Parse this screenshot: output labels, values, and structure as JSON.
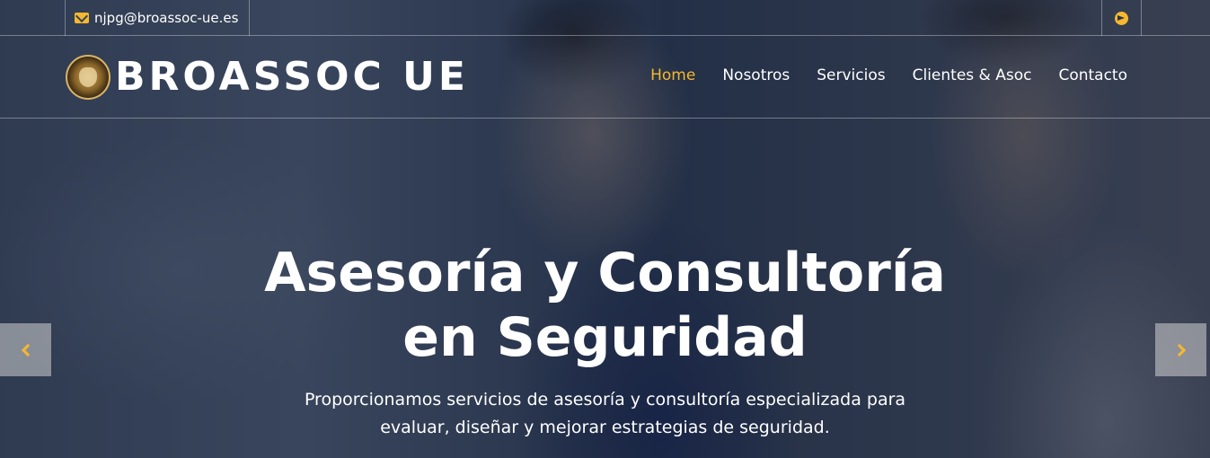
{
  "topbar": {
    "email": "njpg@broassoc-ue.es",
    "email_icon": "envelope-icon",
    "social_icon": "telegram-icon"
  },
  "header": {
    "brand": "BROASSOC UE",
    "logo_icon": "logo-seal"
  },
  "nav": {
    "items": [
      {
        "label": "Home",
        "active": true
      },
      {
        "label": "Nosotros",
        "active": false
      },
      {
        "label": "Servicios",
        "active": false
      },
      {
        "label": "Clientes & Asoc",
        "active": false
      },
      {
        "label": "Contacto",
        "active": false
      }
    ]
  },
  "hero": {
    "title_line1": "Asesoría y Consultoría",
    "title_line2": "en Seguridad",
    "subtitle_line1": "Proporcionamos servicios de asesoría y consultoría especializada para",
    "subtitle_line2": "evaluar, diseñar y mejorar estrategias de seguridad."
  },
  "carousel": {
    "prev_icon": "chevron-left-icon",
    "next_icon": "chevron-right-icon"
  },
  "colors": {
    "accent": "#f5b82e",
    "text": "#ffffff"
  }
}
